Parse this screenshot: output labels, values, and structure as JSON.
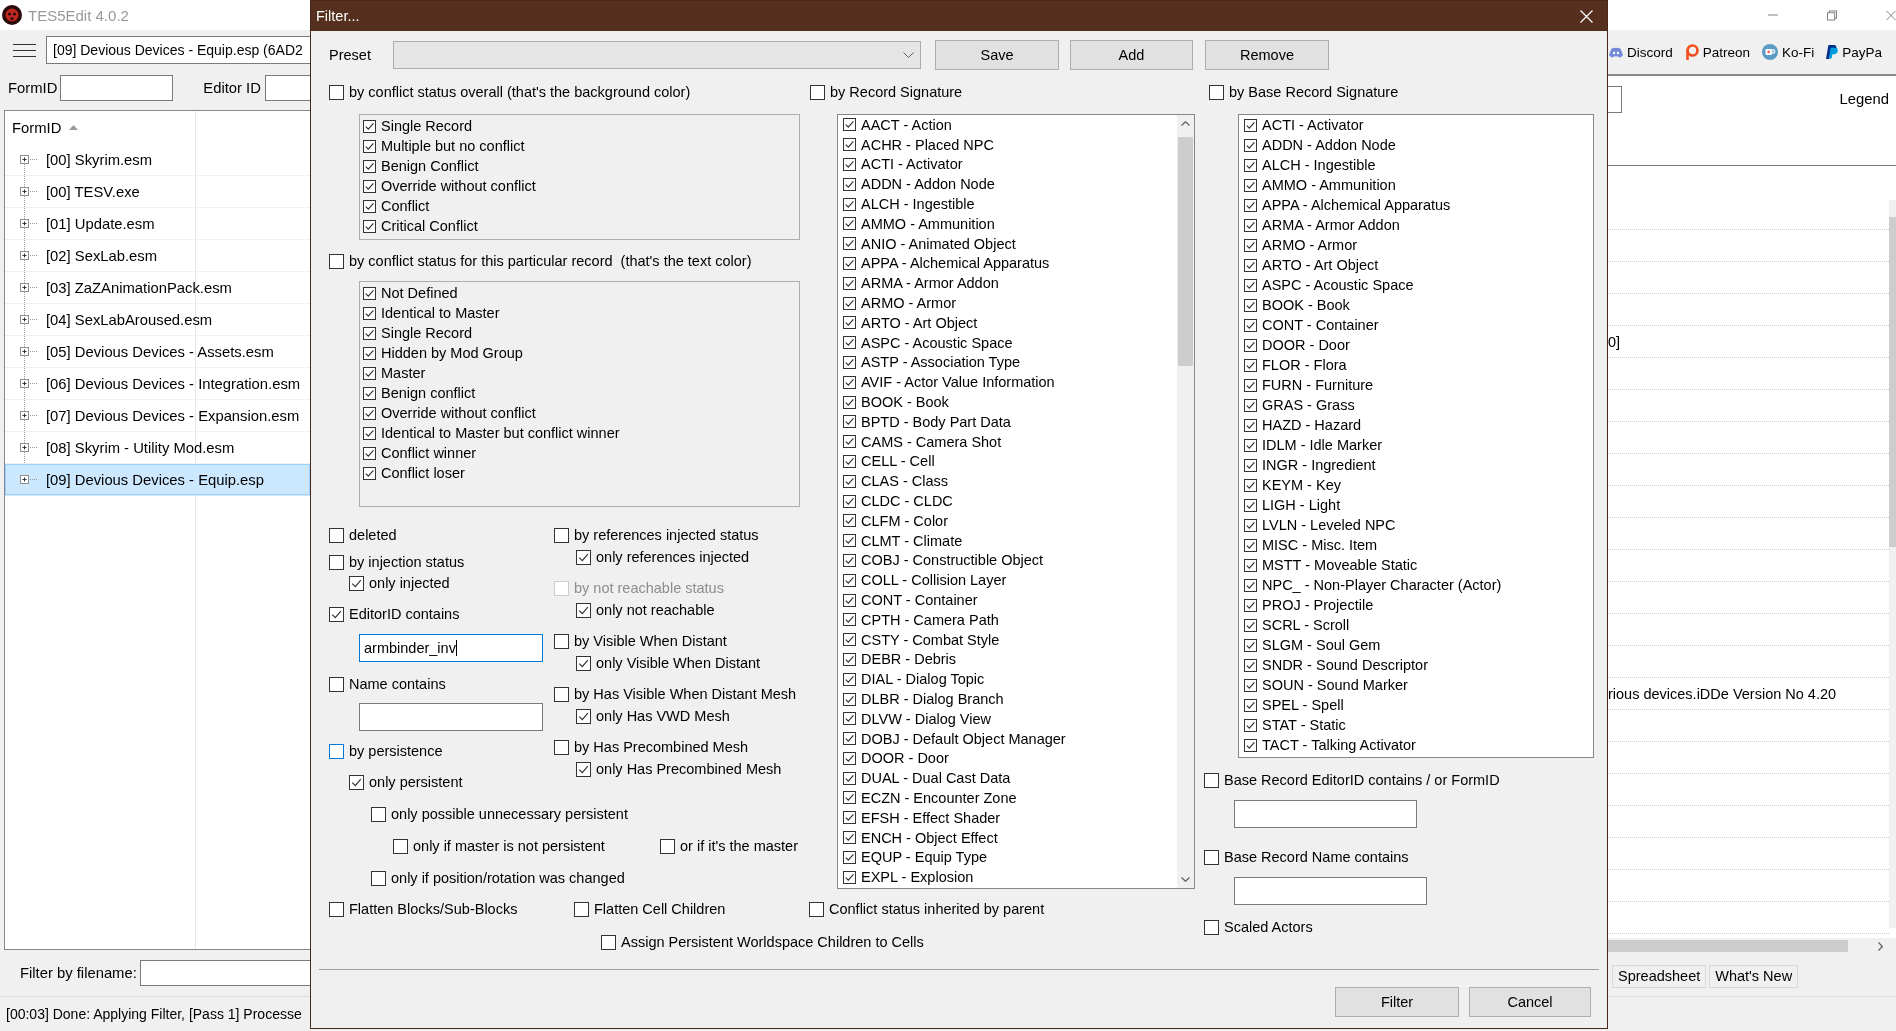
{
  "app": {
    "title": "TES5Edit 4.0.2",
    "file_selector": {
      "value": "[09] Devious Devices - Equip.esp (6AD2"
    },
    "links": [
      {
        "label": "Discord",
        "kind": "controller"
      },
      {
        "label": "Patreon",
        "kind": "ring"
      },
      {
        "label": "Ko-Fi",
        "kind": "cup"
      },
      {
        "label": "PayPa",
        "kind": "emblem"
      }
    ],
    "formid_label": "FormID",
    "editorid_label": "Editor ID",
    "legend": "Legend",
    "tree": {
      "column": "FormID",
      "sort_ascending": true,
      "items": [
        {
          "label": "[00] Skyrim.esm",
          "expanded": false,
          "selected": false
        },
        {
          "label": "[00] TESV.exe",
          "expanded": false,
          "selected": false
        },
        {
          "label": "[01] Update.esm",
          "expanded": false,
          "selected": false
        },
        {
          "label": "[02] SexLab.esm",
          "expanded": false,
          "selected": false
        },
        {
          "label": "[03] ZaZAnimationPack.esm",
          "expanded": false,
          "selected": false
        },
        {
          "label": "[04] SexLabAroused.esm",
          "expanded": false,
          "selected": false
        },
        {
          "label": "[05] Devious Devices - Assets.esm",
          "expanded": false,
          "selected": false
        },
        {
          "label": "[06] Devious Devices - Integration.esm",
          "expanded": false,
          "selected": false
        },
        {
          "label": "[07] Devious Devices - Expansion.esm",
          "expanded": false,
          "selected": false
        },
        {
          "label": "[08] Skyrim - Utility Mod.esm",
          "expanded": false,
          "selected": false
        },
        {
          "label": "[09] Devious Devices - Equip.esp",
          "expanded": false,
          "selected": true
        }
      ]
    },
    "record_view": {
      "cells": [
        "0]",
        "rious devices.iDDe Version No 4.20"
      ]
    },
    "tabs": [
      {
        "label": "Spreadsheet",
        "selected": false
      },
      {
        "label": "What's New",
        "selected": false
      }
    ],
    "filter_label": "Filter by filename:",
    "status": "[00:03] Done: Applying Filter, [Pass 1] Processe"
  },
  "dialog": {
    "title": "Filter...",
    "preset": {
      "label": "Preset"
    },
    "buttons": [
      {
        "label": "Save"
      },
      {
        "label": "Add"
      },
      {
        "label": "Remove"
      }
    ],
    "conflict_overall": {
      "label": "by conflict status overall (that's the background color)",
      "checked": false,
      "items": [
        {
          "label": "Single Record",
          "checked": true
        },
        {
          "label": "Multiple but no conflict",
          "checked": true
        },
        {
          "label": "Benign Conflict",
          "checked": true
        },
        {
          "label": "Override without conflict",
          "checked": true
        },
        {
          "label": "Conflict",
          "checked": true
        },
        {
          "label": "Critical Conflict",
          "checked": true
        }
      ]
    },
    "conflict_record": {
      "label": "by conflict status for this particular record  (that's the text color)",
      "checked": false,
      "items": [
        {
          "label": "Not Defined",
          "checked": true
        },
        {
          "label": "Identical to Master",
          "checked": true
        },
        {
          "label": "Single Record",
          "checked": true
        },
        {
          "label": "Hidden by Mod Group",
          "checked": true
        },
        {
          "label": "Master",
          "checked": true
        },
        {
          "label": "Benign conflict",
          "checked": true
        },
        {
          "label": "Override without conflict",
          "checked": true
        },
        {
          "label": "Identical to Master but conflict winner",
          "checked": true
        },
        {
          "label": "Conflict winner",
          "checked": true
        },
        {
          "label": "Conflict loser",
          "checked": true
        }
      ]
    },
    "options_left": {
      "deleted": {
        "label": "deleted",
        "checked": false,
        "hovered": false
      },
      "injection": {
        "label": "by injection status",
        "checked": false,
        "hovered": false,
        "children": [
          {
            "label": "only injected",
            "checked": true
          }
        ]
      },
      "editor_id": {
        "label": "EditorID contains",
        "checked": true,
        "hovered": false,
        "field": {
          "value": "armbinder_inv",
          "focused": true
        }
      },
      "name": {
        "label": "Name contains",
        "checked": false,
        "hovered": false,
        "field": {
          "focused": false
        }
      },
      "persistence": {
        "label": "by persistence",
        "checked": false,
        "hovered": true,
        "children": [
          {
            "label": "only persistent",
            "checked": true,
            "children": [
              {
                "label": "only possible unnecessary persistent",
                "checked": false,
                "children": [
                  {
                    "label": "only if master is not persistent",
                    "checked": false
                  },
                  {
                    "label": "or if it's the master",
                    "checked": false
                  }
                ]
              },
              {
                "label": "only if position/rotation was changed",
                "checked": false
              }
            ]
          }
        ]
      }
    },
    "options_right": [
      {
        "label": "by references injected status",
        "checked": false,
        "disabled": false,
        "children": [
          {
            "label": "only references injected",
            "checked": true
          }
        ]
      },
      {
        "label": "by not reachable status",
        "checked": false,
        "disabled": true,
        "children": [
          {
            "label": "only not reachable",
            "checked": true
          }
        ]
      },
      {
        "label": "by Visible When Distant",
        "checked": false,
        "disabled": false,
        "children": [
          {
            "label": "only Visible When Distant",
            "checked": true
          }
        ]
      },
      {
        "label": "by Has Visible When Distant Mesh",
        "checked": false,
        "disabled": false,
        "children": [
          {
            "label": "only Has VWD Mesh",
            "checked": true
          }
        ]
      },
      {
        "label": "by Has Precombined Mesh",
        "checked": false,
        "disabled": false,
        "children": [
          {
            "label": "only Has Precombined Mesh",
            "checked": true
          }
        ]
      }
    ],
    "bottom_options": [
      {
        "label": "Flatten Blocks/Sub-Blocks",
        "checked": false
      },
      {
        "label": "Flatten Cell Children",
        "checked": false
      },
      {
        "label": "Conflict status inherited by parent",
        "checked": false
      },
      {
        "label": "Assign Persistent Worldspace Children to Cells",
        "checked": false
      }
    ],
    "record_signature": {
      "label": "by Record Signature",
      "checked": false,
      "items": [
        {
          "label": "AACT - Action",
          "checked": true
        },
        {
          "label": "ACHR - Placed NPC",
          "checked": true
        },
        {
          "label": "ACTI - Activator",
          "checked": true
        },
        {
          "label": "ADDN - Addon Node",
          "checked": true
        },
        {
          "label": "ALCH - Ingestible",
          "checked": true
        },
        {
          "label": "AMMO - Ammunition",
          "checked": true
        },
        {
          "label": "ANIO - Animated Object",
          "checked": true
        },
        {
          "label": "APPA - Alchemical Apparatus",
          "checked": true
        },
        {
          "label": "ARMA - Armor Addon",
          "checked": true
        },
        {
          "label": "ARMO - Armor",
          "checked": true
        },
        {
          "label": "ARTO - Art Object",
          "checked": true
        },
        {
          "label": "ASPC - Acoustic Space",
          "checked": true
        },
        {
          "label": "ASTP - Association Type",
          "checked": true
        },
        {
          "label": "AVIF - Actor Value Information",
          "checked": true
        },
        {
          "label": "BOOK - Book",
          "checked": true
        },
        {
          "label": "BPTD - Body Part Data",
          "checked": true
        },
        {
          "label": "CAMS - Camera Shot",
          "checked": true
        },
        {
          "label": "CELL - Cell",
          "checked": true
        },
        {
          "label": "CLAS - Class",
          "checked": true
        },
        {
          "label": "CLDC - CLDC",
          "checked": true
        },
        {
          "label": "CLFM - Color",
          "checked": true
        },
        {
          "label": "CLMT - Climate",
          "checked": true
        },
        {
          "label": "COBJ - Constructible Object",
          "checked": true
        },
        {
          "label": "COLL - Collision Layer",
          "checked": true
        },
        {
          "label": "CONT - Container",
          "checked": true
        },
        {
          "label": "CPTH - Camera Path",
          "checked": true
        },
        {
          "label": "CSTY - Combat Style",
          "checked": true
        },
        {
          "label": "DEBR - Debris",
          "checked": true
        },
        {
          "label": "DIAL - Dialog Topic",
          "checked": true
        },
        {
          "label": "DLBR - Dialog Branch",
          "checked": true
        },
        {
          "label": "DLVW - Dialog View",
          "checked": true
        },
        {
          "label": "DOBJ - Default Object Manager",
          "checked": true
        },
        {
          "label": "DOOR - Door",
          "checked": true
        },
        {
          "label": "DUAL - Dual Cast Data",
          "checked": true
        },
        {
          "label": "ECZN - Encounter Zone",
          "checked": true
        },
        {
          "label": "EFSH - Effect Shader",
          "checked": true
        },
        {
          "label": "ENCH - Object Effect",
          "checked": true
        },
        {
          "label": "EQUP - Equip Type",
          "checked": true
        },
        {
          "label": "EXPL - Explosion",
          "checked": true
        }
      ]
    },
    "base_record_signature": {
      "label": "by Base Record Signature",
      "checked": false,
      "items": [
        {
          "label": "ACTI - Activator",
          "checked": true
        },
        {
          "label": "ADDN - Addon Node",
          "checked": true
        },
        {
          "label": "ALCH - Ingestible",
          "checked": true
        },
        {
          "label": "AMMO - Ammunition",
          "checked": true
        },
        {
          "label": "APPA - Alchemical Apparatus",
          "checked": true
        },
        {
          "label": "ARMA - Armor Addon",
          "checked": true
        },
        {
          "label": "ARMO - Armor",
          "checked": true
        },
        {
          "label": "ARTO - Art Object",
          "checked": true
        },
        {
          "label": "ASPC - Acoustic Space",
          "checked": true
        },
        {
          "label": "BOOK - Book",
          "checked": true
        },
        {
          "label": "CONT - Container",
          "checked": true
        },
        {
          "label": "DOOR - Door",
          "checked": true
        },
        {
          "label": "FLOR - Flora",
          "checked": true
        },
        {
          "label": "FURN - Furniture",
          "checked": true
        },
        {
          "label": "GRAS - Grass",
          "checked": true
        },
        {
          "label": "HAZD - Hazard",
          "checked": true
        },
        {
          "label": "IDLM - Idle Marker",
          "checked": true
        },
        {
          "label": "INGR - Ingredient",
          "checked": true
        },
        {
          "label": "KEYM - Key",
          "checked": true
        },
        {
          "label": "LIGH - Light",
          "checked": true
        },
        {
          "label": "LVLN - Leveled NPC",
          "checked": true
        },
        {
          "label": "MISC - Misc. Item",
          "checked": true
        },
        {
          "label": "MSTT - Moveable Static",
          "checked": true
        },
        {
          "label": "NPC_ - Non-Player Character (Actor)",
          "checked": true
        },
        {
          "label": "PROJ - Projectile",
          "checked": true
        },
        {
          "label": "SCRL - Scroll",
          "checked": true
        },
        {
          "label": "SLGM - Soul Gem",
          "checked": true
        },
        {
          "label": "SNDR - Sound Descriptor",
          "checked": true
        },
        {
          "label": "SOUN - Sound Marker",
          "checked": true
        },
        {
          "label": "SPEL - Spell",
          "checked": true
        },
        {
          "label": "STAT - Static",
          "checked": true
        },
        {
          "label": "TACT - Talking Activator",
          "checked": true
        }
      ]
    },
    "base_record_filters": [
      {
        "label": "Base Record EditorID contains / or FormID",
        "checked": false,
        "field": {
          "focused": false
        }
      },
      {
        "label": "Base Record Name contains",
        "checked": false,
        "field": {
          "focused": false
        }
      },
      {
        "label": "Scaled Actors",
        "checked": false
      }
    ],
    "footer_buttons": [
      {
        "label": "Filter"
      },
      {
        "label": "Cancel"
      }
    ]
  }
}
